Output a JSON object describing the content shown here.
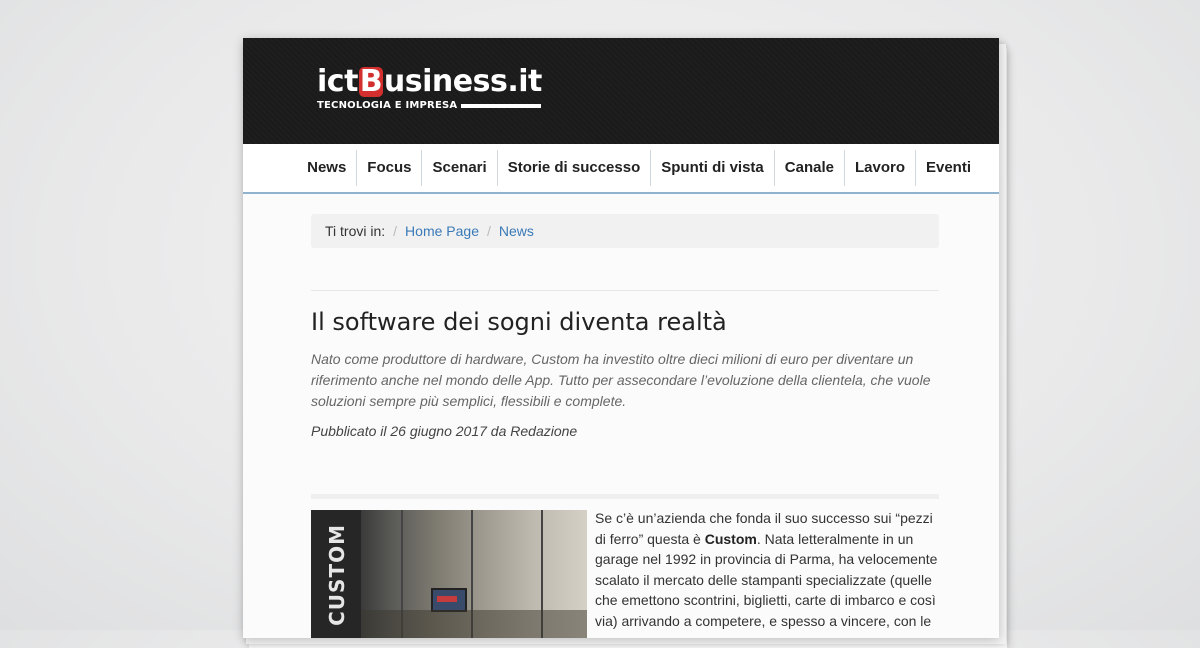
{
  "site": {
    "logo_pre": "ict",
    "logo_b": "B",
    "logo_post": "usiness.it",
    "tagline": "TECNOLOGIA E IMPRESA"
  },
  "nav": {
    "items": [
      "News",
      "Focus",
      "Scenari",
      "Storie di successo",
      "Spunti di vista",
      "Canale",
      "Lavoro",
      "Eventi"
    ]
  },
  "breadcrumb": {
    "prefix": "Ti trovi in:",
    "links": [
      "Home Page",
      "News"
    ]
  },
  "article": {
    "title": "Il software dei sogni diventa realtà",
    "subtitle": "Nato come produttore di hardware, Custom ha investito oltre dieci milioni di euro per diventare un riferimento anche nel mondo delle App. Tutto per assecondare l’evoluzione della clientela, che vuole soluzioni sempre più semplici, flessibili e complete.",
    "published": "Pubblicato il 26 giugno 2017 da Redazione",
    "image_brand": "CUSTOM",
    "body_part1": "Se c’è un’azienda che fonda il suo successo sui “pezzi di ferro” questa è ",
    "body_bold": "Custom",
    "body_part2": ". Nata letteralmente in un garage nel 1992 in provincia di Parma, ha velocemente scalato il mercato delle stampanti specializzate (quelle che emettono scontrini, biglietti, carte di imbarco e così via) arrivando a competere, e spesso a vincere, con le"
  }
}
